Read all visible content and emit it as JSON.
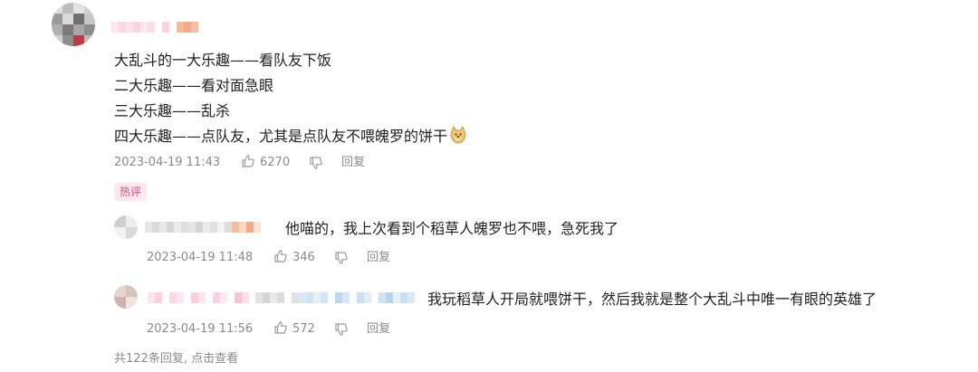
{
  "main_comment": {
    "lines": [
      "大乱斗的一大乐趣——看队友下饭",
      "二大乐趣——看对面急眼",
      "三大乐趣——乱杀",
      "四大乐趣——点队友，尤其是点队友不喂魄罗的饼干"
    ],
    "emoji_icon": "doge-icon",
    "timestamp": "2023-04-19 11:43",
    "likes": "6270",
    "reply_label": "回复",
    "hot_tag": "热评"
  },
  "replies": [
    {
      "text": "他喵的，我上次看到个稻草人魄罗也不喂，急死我了",
      "timestamp": "2023-04-19 11:48",
      "likes": "346",
      "reply_label": "回复"
    },
    {
      "text": "我玩稻草人开局就喂饼干，然后我就是整个大乱斗中唯一有眼的英雄了",
      "timestamp": "2023-04-19 11:56",
      "likes": "572",
      "reply_label": "回复"
    }
  ],
  "footer": {
    "more_replies": "共122条回复, 点击查看"
  },
  "colors": {
    "text": "#1f1f1f",
    "meta": "#8a8a8a",
    "tag_text": "#e24a76",
    "tag_bg": "#fde8ef"
  }
}
